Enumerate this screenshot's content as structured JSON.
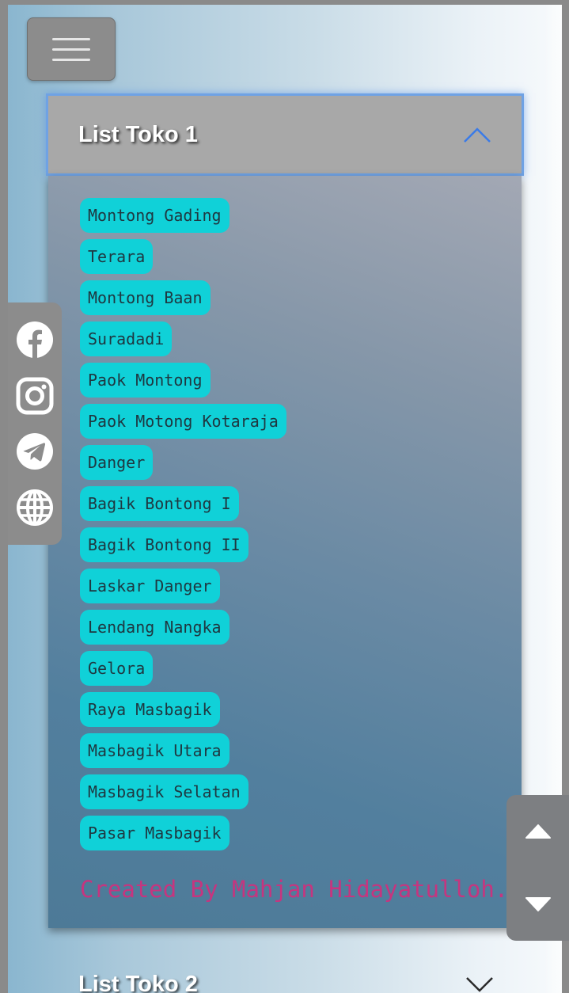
{
  "accordion_1": {
    "title": "List Toko 1",
    "expanded": true,
    "items": [
      "Montong Gading",
      "Terara",
      "Montong Baan",
      "Suradadi",
      "Paok Montong",
      "Paok Motong Kotaraja",
      "Danger",
      "Bagik Bontong I",
      "Bagik Bontong II",
      "Laskar Danger",
      "Lendang Nangka",
      "Gelora",
      "Raya Masbagik",
      "Masbagik Utara",
      "Masbagik Selatan",
      "Pasar Masbagik"
    ],
    "credit": "Created By Mahjan Hidayatulloh."
  },
  "accordion_2": {
    "title": "List Toko 2",
    "expanded": false
  },
  "social": [
    "facebook-icon",
    "instagram-icon",
    "telegram-icon",
    "globe-icon"
  ],
  "colors": {
    "chip": "#10d1d8",
    "credit": "#c6357f",
    "chevron_open": "#3a7be8",
    "header_border": "#6fa2e4"
  }
}
